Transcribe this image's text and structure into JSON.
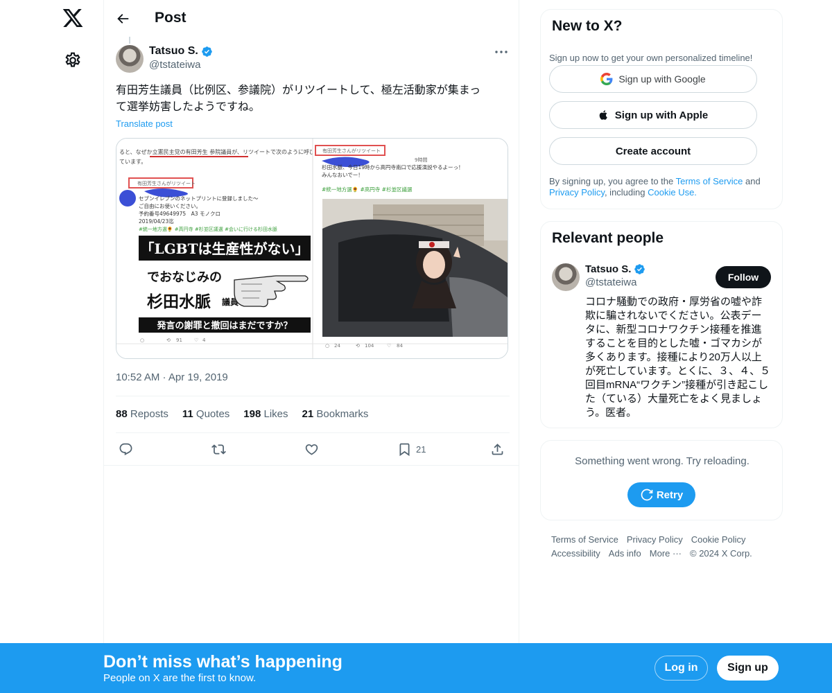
{
  "nav": {
    "logo": "x-logo-icon",
    "settings": "gear-icon"
  },
  "header": {
    "title": "Post",
    "back": "arrow-left-icon"
  },
  "post": {
    "author_name": "Tatsuo S.",
    "author_handle": "@tstateiwa",
    "text_line1": "有田芳生議員（比例区、参議院）がリツイートして、極左活動家が集まっ",
    "text_line2": "て選挙妨害したようですね。",
    "translate": "Translate post",
    "timestamp": "10:52 AM · Apr 19, 2019",
    "stats": {
      "reposts_count": "88",
      "reposts_label": "Reposts",
      "quotes_count": "11",
      "quotes_label": "Quotes",
      "likes_count": "198",
      "likes_label": "Likes",
      "bookmarks_count": "21",
      "bookmarks_label": "Bookmarks"
    },
    "actions": {
      "bookmark_count": "21"
    },
    "media": {
      "left_banner_1": "「LGBTは生産性がない」",
      "left_banner_2": "でおなじみの",
      "left_banner_3": "杉田水脈",
      "left_banner_3b": "議員",
      "left_banner_4": "発言の謝罪と撤回はまだですか？",
      "left_top_text": "ると、なぜか立憲民主党の有田芳生 参院議員が、リツイートで次のように呼び",
      "left_top_text2": "ています。",
      "left_rt_badge": "有田芳生さんがリツイート",
      "left_lines": [
        "セブンイレブンのネットプリントに登録しました〜",
        "ご自由にお使いください。",
        "予約番号49649975　A3 モノクロ",
        "2019/04/23迄",
        "#統一地方選🌻 #高円寺 #杉並区議選 #会いに行ける杉田水脈"
      ],
      "left_counts": [
        "91",
        "4"
      ],
      "right_rt_badge": "有田芳生さんがリツイート",
      "right_time": "9時間",
      "right_line1": "杉田水脈、今日19時から高円寺南口で応援演説やるよーっ！",
      "right_line2": "みんなおいでー！",
      "right_tags": "#統一地方選🌻 #高円寺 #杉並区議選",
      "right_counts": [
        "24",
        "104",
        "84"
      ]
    }
  },
  "signup_card": {
    "title": "New to X?",
    "subtitle": "Sign up now to get your own personalized timeline!",
    "google": "Sign up with Google",
    "apple": "Sign up with Apple",
    "create": "Create account",
    "terms_prefix": "By signing up, you agree to the ",
    "terms_link": "Terms of Service",
    "terms_and": " and",
    "privacy_link": "Privacy Policy",
    "terms_including": ", including ",
    "cookie_link": "Cookie Use."
  },
  "relevant": {
    "title": "Relevant people",
    "name": "Tatsuo S.",
    "handle": "@tstateiwa",
    "follow": "Follow",
    "bio": "コロナ騒動での政府・厚労省の嘘や詐欺に騙されないでください。公表データに、新型コロナワクチン接種を推進することを目的とした嘘・ゴマカシが多くあります。接種により20万人以上が死亡しています。とくに、３、４、５回目mRNA“ワクチン”接種が引き起こした（ている）大量死亡をよく見ましょう。医者。"
  },
  "error_card": {
    "message": "Something went wrong. Try reloading.",
    "retry": "Retry"
  },
  "footer": [
    "Terms of Service",
    "Privacy Policy",
    "Cookie Policy",
    "Accessibility",
    "Ads info",
    "More ···",
    "© 2024 X Corp."
  ],
  "banner": {
    "headline": "Don’t miss what’s happening",
    "sub": "People on X are the first to know.",
    "login": "Log in",
    "signup": "Sign up"
  },
  "colors": {
    "accent": "#1d9bf0",
    "text": "#0f1419",
    "muted": "#536471",
    "border": "#eff3f4"
  }
}
